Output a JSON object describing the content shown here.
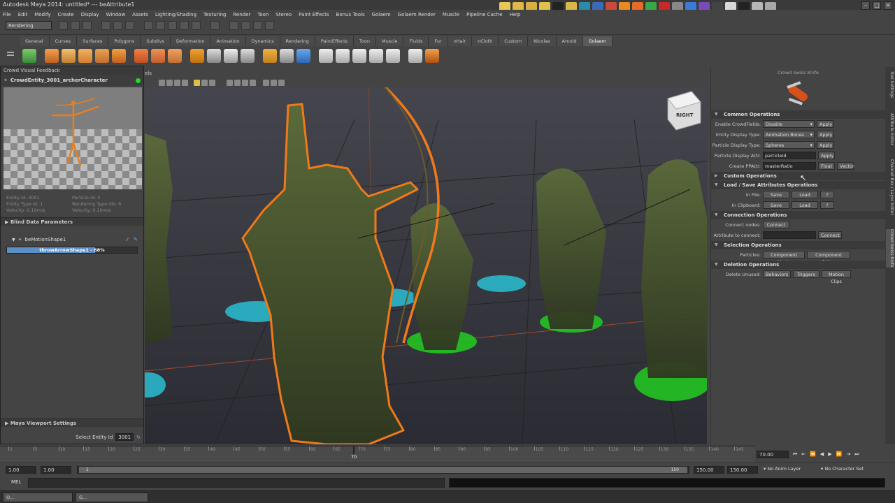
{
  "window": {
    "title": "Autodesk Maya 2014: untitled*  ---  beAttribute1"
  },
  "menu": [
    "File",
    "Edit",
    "Modify",
    "Create",
    "Display",
    "Window",
    "Assets",
    "Lighting/Shading",
    "Texturing",
    "Render",
    "Toon",
    "Stereo",
    "Paint Effects",
    "Bonus Tools",
    "Golaem",
    "Golaem Render",
    "Muscle",
    "Pipeline Cache",
    "Help"
  ],
  "status_line": {
    "mode": "Rendering"
  },
  "shelf_tabs": [
    "General",
    "Curves",
    "Surfaces",
    "Polygons",
    "Subdivs",
    "Deformation",
    "Animation",
    "Dynamics",
    "Rendering",
    "PaintEffects",
    "Toon",
    "Muscle",
    "Fluids",
    "Fur",
    "nHair",
    "nCloth",
    "Custom",
    "Nicolas",
    "Arnold",
    "Golaem"
  ],
  "active_shelf_tab": "Golaem",
  "crowd_visual_feedback": {
    "title": "Crowd Visual Feedback",
    "entity": "CrowdEntity_3001_archerCharacter",
    "info": {
      "entity_id": "Entity id: 3001",
      "particle_id": "Particle id: 2",
      "entity_type_id": "Entity Type id: 1",
      "rendering_type": "Rendering Type idx: 6",
      "velocity1": "Velocity: 0.10m/s",
      "velocity2": "Velocity: 0.10m/s"
    },
    "blind_data_header": "Blind Data Parameters",
    "motion_shape": "beMotionShape1",
    "progress_label": "throwArrowShape1 - 68%",
    "progress_value": 0.68,
    "viewport_settings_header": "Maya Viewport Settings",
    "select_entity_label": "Select Entity Id",
    "select_entity_value": "3001"
  },
  "viewport": {
    "panel_label": "els",
    "view_cube_label": "RIGHT"
  },
  "crowd_swiss_knife": {
    "title": "Crowd Swiss Knife",
    "common_ops": "Common Operations",
    "rows": [
      {
        "label": "Enable CrowdFields:",
        "value": "Disable",
        "kind": "dropdown",
        "buttons": [
          "Apply"
        ]
      },
      {
        "label": "Entity Display Type:",
        "value": "Animation Bones",
        "kind": "dropdown",
        "buttons": [
          "Apply"
        ]
      },
      {
        "label": "Particle Display Type:",
        "value": "Spheres",
        "kind": "dropdown",
        "buttons": [
          "Apply"
        ]
      },
      {
        "label": "Particle Display Attr:",
        "value": "particleId",
        "kind": "text",
        "buttons": [
          "Apply"
        ]
      },
      {
        "label": "Create PPAttr:",
        "value": "masterRatio",
        "kind": "text",
        "buttons": [
          "Float",
          "Vector"
        ]
      }
    ],
    "custom_ops": "Custom Operations",
    "load_save_ops": "Load / Save Attributes Operations",
    "in_file_label": "In File:",
    "in_clipboard_label": "In Clipboard:",
    "save_label": "Save",
    "load_label": "Load",
    "help_label": "?",
    "connection_ops": "Connection Operations",
    "connect_nodes_label": "Connect nodes:",
    "connect_label": "Connect",
    "attr_connect_label": "Attribute to connect:",
    "selection_ops": "Selection Operations",
    "particles_label": "Particles:",
    "component_mode": "Component Mode",
    "component_editor": "Component Editor",
    "deletion_ops": "Deletion Operations",
    "delete_unused_label": "Delete Unused:",
    "behaviors": "Behaviors",
    "triggers": "Triggers",
    "motion_clips": "Motion Clips"
  },
  "side_tabs": [
    "Tool Settings",
    "Attribute Editor",
    "Channel Box / Layer Editor",
    "Crowd Swiss Knife"
  ],
  "timeline": {
    "ticks": [
      "2",
      "5",
      "10",
      "15",
      "20",
      "25",
      "30",
      "35",
      "40",
      "45",
      "50",
      "55",
      "60",
      "65",
      "70",
      "75",
      "80",
      "85",
      "90",
      "95",
      "100",
      "105",
      "110",
      "115",
      "120",
      "125",
      "130",
      "135",
      "140",
      "145"
    ],
    "current_frame": "70",
    "current_frame_field": "70.00"
  },
  "range": {
    "start": "1.00",
    "start2": "1.00",
    "range_start": "1",
    "range_end": "150",
    "end": "150.00",
    "end2": "150.00",
    "anim_layer": "No Anim Layer",
    "character_set": "No Character Set"
  },
  "mel": {
    "label": "MEL"
  },
  "taskbar": [
    "O...",
    "G..."
  ],
  "colors": {
    "accent_orange": "#f07a1a",
    "cyan_marker": "#28c8dc",
    "green_marker": "#22cc22"
  }
}
